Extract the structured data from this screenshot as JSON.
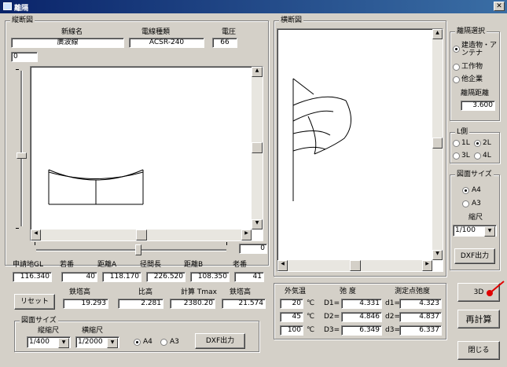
{
  "window": {
    "title": "離隔"
  },
  "elevation": {
    "group_label": "縦断図",
    "headers": {
      "line_name": "新線名",
      "wire_type": "電線種類",
      "voltage": "電圧"
    },
    "values": {
      "line_name": "廣波線",
      "wire_type": "ACSR-240",
      "voltage": "66"
    },
    "left_slider_value": "0",
    "bottom_slider_value": "0",
    "station_headers": [
      "申請地GL",
      "若番",
      "距離A",
      "径間長",
      "距離B",
      "老番"
    ],
    "station_values": [
      "116.340",
      "40",
      "118.170",
      "226.520",
      "108.350",
      "41"
    ],
    "reset_label": "リセット",
    "tower_headers": [
      "鉄塔高",
      "比高",
      "計算 Tmax",
      "鉄塔高"
    ],
    "tower_values": [
      "19.293",
      "2.281",
      "2380.20",
      "21.574"
    ],
    "print_group": {
      "label": "図面サイズ",
      "v_scale_label": "縦縮尺",
      "h_scale_label": "横縮尺",
      "v_scale": "1/400",
      "h_scale": "1/2000",
      "size_a4": "A4",
      "size_a3": "A3",
      "selected": "A4",
      "dxf_label": "DXF出力"
    }
  },
  "cross_section": {
    "group_label": "横断図"
  },
  "separation": {
    "group_label": "離隔選択",
    "options": [
      "建造物・アンテナ",
      "工作物",
      "他企業"
    ],
    "selected": "建造物・アンテナ",
    "distance_label": "離隔距離",
    "distance_value": "3.600"
  },
  "l_side": {
    "group_label": "L側",
    "options": [
      "1L",
      "2L",
      "3L",
      "4L"
    ],
    "selected": "2L"
  },
  "drawing_size": {
    "group_label": "図面サイズ",
    "options": [
      "A4",
      "A3"
    ],
    "selected": "A4",
    "scale_label": "縮尺",
    "scale_value": "1/100",
    "dxf_label": "DXF出力"
  },
  "results": {
    "col_headers": {
      "temp": "外気温",
      "sag": "弛 度",
      "point_sag": "測定点弛度"
    },
    "rows": [
      {
        "temp": "20",
        "unit": "℃",
        "d_label": "D1=",
        "d": "4.331",
        "dd_label": "d1=",
        "dd": "4.323"
      },
      {
        "temp": "45",
        "unit": "℃",
        "d_label": "D2=",
        "d": "4.846",
        "dd_label": "d2=",
        "dd": "4.837"
      },
      {
        "temp": "100",
        "unit": "℃",
        "d_label": "D3=",
        "d": "6.349",
        "dd_label": "d3=",
        "dd": "6.337"
      }
    ]
  },
  "buttons": {
    "view3d": "3D",
    "recalc": "再計算",
    "close": "閉じる"
  },
  "colors": {
    "titlebar": "#0a246a",
    "pointer": "#e00000"
  }
}
